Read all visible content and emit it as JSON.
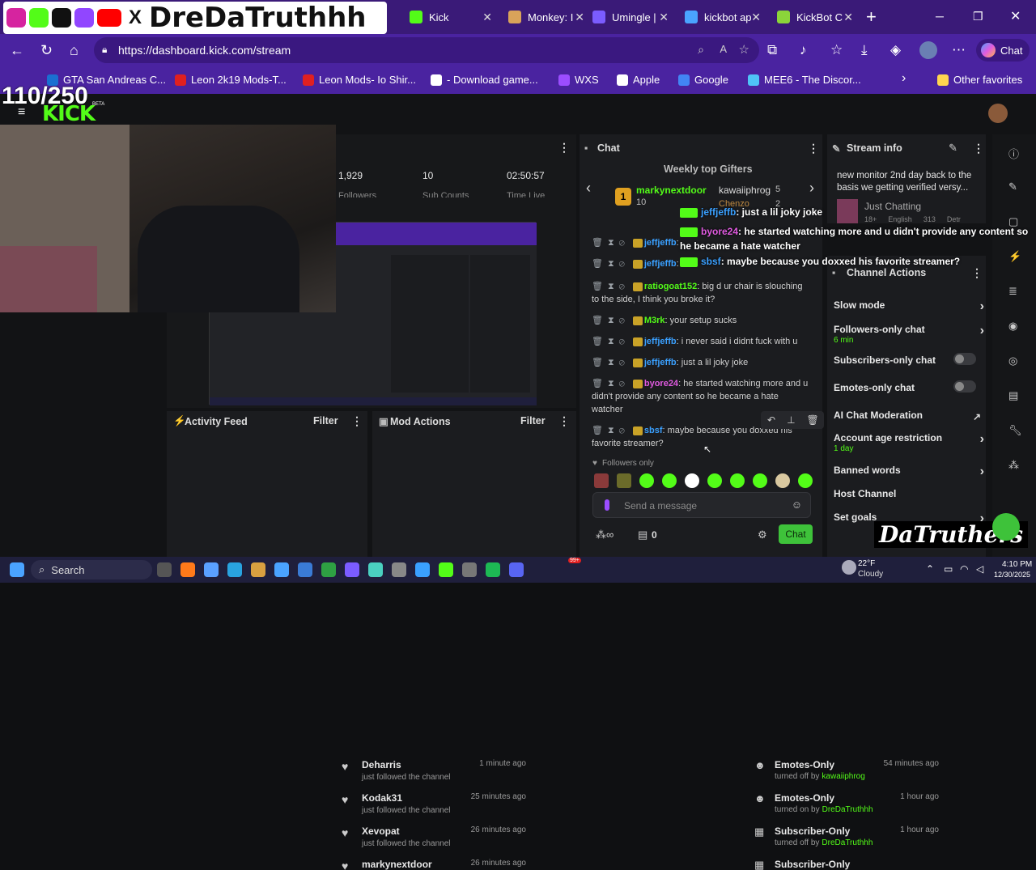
{
  "overlay": {
    "brand": "DreDaTruthhh",
    "follower_goal": "110/250",
    "watermark": "DaTruthers"
  },
  "tabs": [
    {
      "label": "Kick",
      "color": "#53fc18"
    },
    {
      "label": "Monkey: I",
      "color": "#d9a35a"
    },
    {
      "label": "Umingle | ",
      "color": "#7b5cff"
    },
    {
      "label": "kickbot ap",
      "color": "#4aa3ff"
    },
    {
      "label": "KickBot C",
      "color": "#8bd43a"
    }
  ],
  "address": {
    "url": "https://dashboard.kick.com/stream"
  },
  "bookmarks": [
    {
      "label": "GTA San Andreas C...",
      "color": "#1a6fd1"
    },
    {
      "label": "Leon 2k19 Mods-T...",
      "color": "#e02020"
    },
    {
      "label": "Leon Mods- Io Shir...",
      "color": "#e02020"
    },
    {
      "label": "- Download game...",
      "color": "#ffffff"
    },
    {
      "label": "WXS",
      "color": "#9b4dff"
    },
    {
      "label": "Apple",
      "color": "#ffffff"
    },
    {
      "label": "Google",
      "color": "#4285f4"
    },
    {
      "label": "MEE6 - The Discor...",
      "color": "#4fc3f7"
    },
    {
      "label": "Other favorites",
      "color": "#ffd54f"
    }
  ],
  "kick": {
    "logo": "KICK",
    "beta": "BETA"
  },
  "stats": [
    {
      "value": "1,929",
      "label": "Followers"
    },
    {
      "value": "10",
      "label": "Sub Counts"
    },
    {
      "value": "02:50:57",
      "label": "Time Live"
    }
  ],
  "chat": {
    "title": "Chat",
    "gifters_title": "Weekly top Gifters",
    "gifters": [
      {
        "rank": "1",
        "name": "markynextdoor",
        "count": "10"
      },
      {
        "rank": "",
        "name": "kawaiiphrog",
        "count": "5"
      },
      {
        "rank": "",
        "name": "Chenzo",
        "count": "2"
      }
    ],
    "messages": [
      {
        "user": "jeffjeffb",
        "text": "",
        "color": "#3aa0ff"
      },
      {
        "user": "jeffjeffb",
        "text": "",
        "color": "#3aa0ff"
      },
      {
        "user": "ratiogoat152",
        "text": "big d ur chair is slouching to the side, I think you broke it?",
        "color": "#53fc18"
      },
      {
        "user": "M3rk",
        "text": "your setup sucks",
        "color": "#53fc18"
      },
      {
        "user": "jeffjeffb",
        "text": "i never said i didnt fuck with u",
        "color": "#3aa0ff"
      },
      {
        "user": "jeffjeffb",
        "text": "just a lil joky joke",
        "color": "#3aa0ff"
      },
      {
        "user": "byore24",
        "text": "he started watching more and u didn't provide any content so he became a hate watcher",
        "color": "#e05ae0"
      },
      {
        "user": "sbsf",
        "text": "maybe because you doxxed his favorite streamer?",
        "color": "#3aa0ff"
      }
    ],
    "followers_only": "Followers only",
    "input_placeholder": "Send a message",
    "chat_button": "Chat",
    "count": "0",
    "emote_colors": [
      "#8a3a3a",
      "#6b6b2a",
      "#53fc18",
      "#53fc18",
      "#ffffff",
      "#53fc18",
      "#53fc18",
      "#53fc18",
      "#d9c8a0",
      "#53fc18"
    ]
  },
  "overlay_chat": [
    {
      "user": "jeffjeffb",
      "text": ": just a lil joky joke"
    },
    {
      "user": "byore24",
      "text": ": he started watching more and u didn't provide any content so he became a hate watcher"
    },
    {
      "user": "sbsf",
      "text": ": maybe because you doxxed his favorite streamer?"
    }
  ],
  "stream_info": {
    "title": "Stream info",
    "stream_title": "new monitor 2nd day back to the basis we getting verified versy...",
    "category": "Just Chatting",
    "tags": [
      "18+",
      "English",
      "313",
      "Detr"
    ]
  },
  "channel_actions": {
    "title": "Channel Actions",
    "rows": [
      {
        "label": "Slow mode",
        "sub": "",
        "control": "chevron"
      },
      {
        "label": "Followers-only chat",
        "sub": "6 min",
        "control": "chevron"
      },
      {
        "label": "Subscribers-only chat",
        "sub": "",
        "control": "toggle"
      },
      {
        "label": "Emotes-only chat",
        "sub": "",
        "control": "toggle"
      },
      {
        "label": "AI Chat Moderation",
        "sub": "",
        "control": "external"
      },
      {
        "label": "Account age restriction",
        "sub": "1 day",
        "control": "chevron"
      },
      {
        "label": "Banned words",
        "sub": "",
        "control": "chevron"
      },
      {
        "label": "Host Channel",
        "sub": "",
        "control": "none"
      },
      {
        "label": "Set goals",
        "sub": "",
        "control": "chevron"
      }
    ]
  },
  "activity_feed": {
    "title": "Activity Feed",
    "filter": "Filter",
    "items": [
      {
        "name": "Deharris",
        "sub": "just followed the channel",
        "time": "1 minute ago"
      },
      {
        "name": "Kodak31",
        "sub": "just followed the channel",
        "time": "25 minutes ago"
      },
      {
        "name": "Xevopat",
        "sub": "just followed the channel",
        "time": "26 minutes ago"
      },
      {
        "name": "markynextdoor",
        "sub": "",
        "time": "26 minutes ago"
      }
    ]
  },
  "mod_actions": {
    "title": "Mod Actions",
    "filter": "Filter",
    "items": [
      {
        "name": "Emotes-Only",
        "verb": "turned off by",
        "by": "kawaiiphrog",
        "time": "54 minutes ago"
      },
      {
        "name": "Emotes-Only",
        "verb": "turned on by",
        "by": "DreDaTruthhh",
        "time": "1 hour ago"
      },
      {
        "name": "Subscriber-Only",
        "verb": "turned off by",
        "by": "DreDaTruthhh",
        "time": "1 hour ago"
      },
      {
        "name": "Subscriber-Only",
        "verb": "",
        "by": "",
        "time": ""
      }
    ]
  },
  "taskbar": {
    "search": "Search",
    "weather": {
      "temp": "22°F",
      "desc": "Cloudy"
    },
    "time": "4:10 PM",
    "date": "12/30/2025",
    "badge": "99+"
  }
}
